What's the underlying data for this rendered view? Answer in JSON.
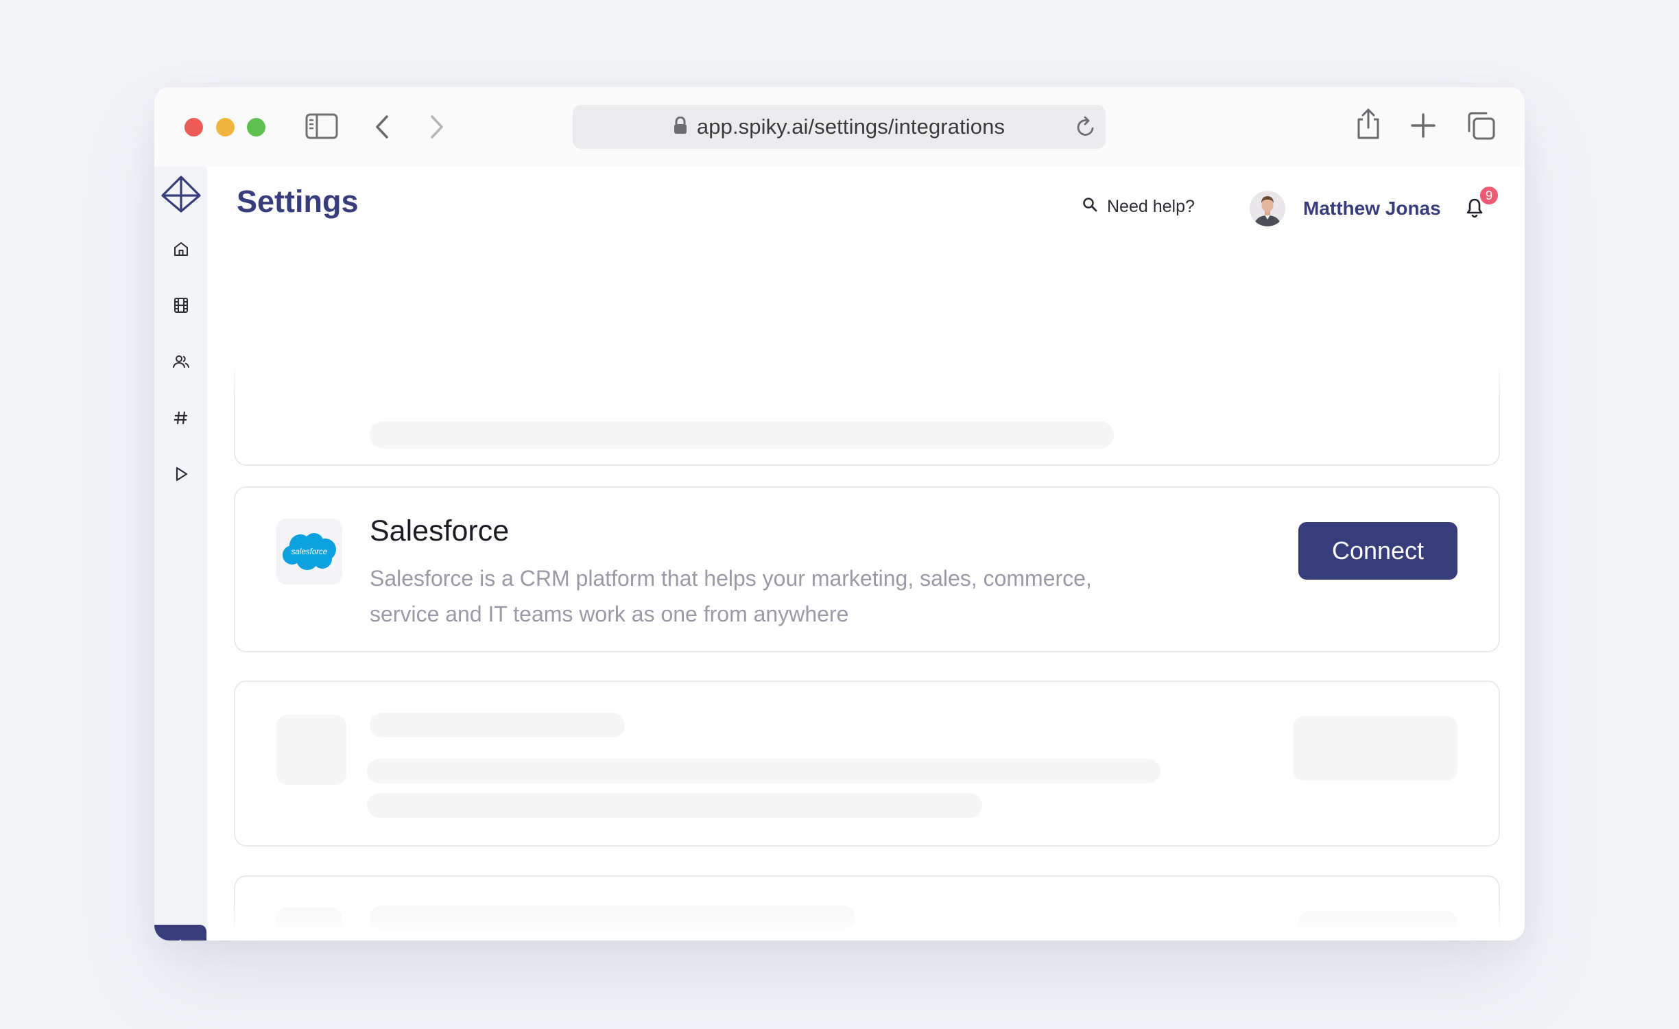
{
  "browser": {
    "url": "app.spiky.ai/settings/integrations"
  },
  "sidebar": {
    "items": [
      {
        "icon": "logo-icon"
      },
      {
        "icon": "home-icon"
      },
      {
        "icon": "film-icon"
      },
      {
        "icon": "users-icon"
      },
      {
        "icon": "hashtag-icon"
      },
      {
        "icon": "play-icon"
      },
      {
        "icon": "settings-icon",
        "active": true
      },
      {
        "icon": "logout-icon"
      }
    ]
  },
  "header": {
    "title": "Settings",
    "help_label": "Need help?",
    "user_name": "Matthew Jonas",
    "notification_count": "9"
  },
  "integration": {
    "name": "Salesforce",
    "logo_text": "salesforce",
    "description": "Salesforce is a CRM platform that helps your marketing, sales, commerce, service and IT teams work as one from anywhere",
    "button_label": "Connect"
  },
  "colors": {
    "accent": "#373d7a",
    "badge": "#ef5a73",
    "salesforce_blue": "#0da1e0"
  }
}
